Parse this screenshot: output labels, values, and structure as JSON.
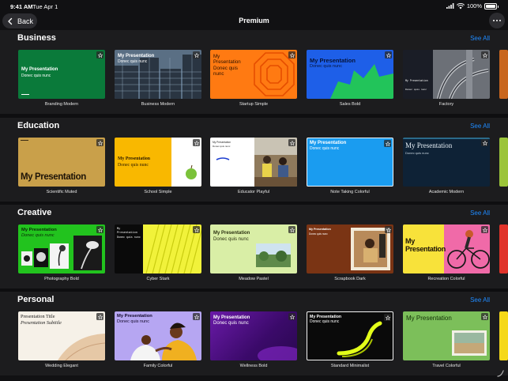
{
  "status": {
    "time": "9:41 AM",
    "date": "Tue Apr 1",
    "battery": "100%"
  },
  "nav": {
    "back_label": "Back",
    "title": "Premium"
  },
  "see_all": "See All",
  "slide_title": "My Presentation",
  "slide_subtitle": "Donec quis nunc",
  "sections": [
    {
      "title": "Business",
      "items": [
        "Branding Modern",
        "Business Modern",
        "Startup Simple",
        "Sales Bold",
        "Factory"
      ]
    },
    {
      "title": "Education",
      "items": [
        "Scientific Muted",
        "School Simple",
        "Educator Playful",
        "Note Taking Colorful",
        "Academic Modern"
      ]
    },
    {
      "title": "Creative",
      "items": [
        "Photography Bold",
        "Cyber Stark",
        "Meadow Pastel",
        "Scrapbook Dark",
        "Recreation Colorful"
      ]
    },
    {
      "title": "Personal",
      "items": [
        "Wedding Elegant",
        "Family Colorful",
        "Wellness Bold",
        "Standard Minimalist",
        "Travel Colorful"
      ]
    }
  ],
  "wedding": {
    "title": "Presentation Title",
    "subtitle": "Presentation Subtitle"
  },
  "colors": {
    "accent": "#1f8bff",
    "background": "#111113",
    "section": "#1c1c1e"
  }
}
